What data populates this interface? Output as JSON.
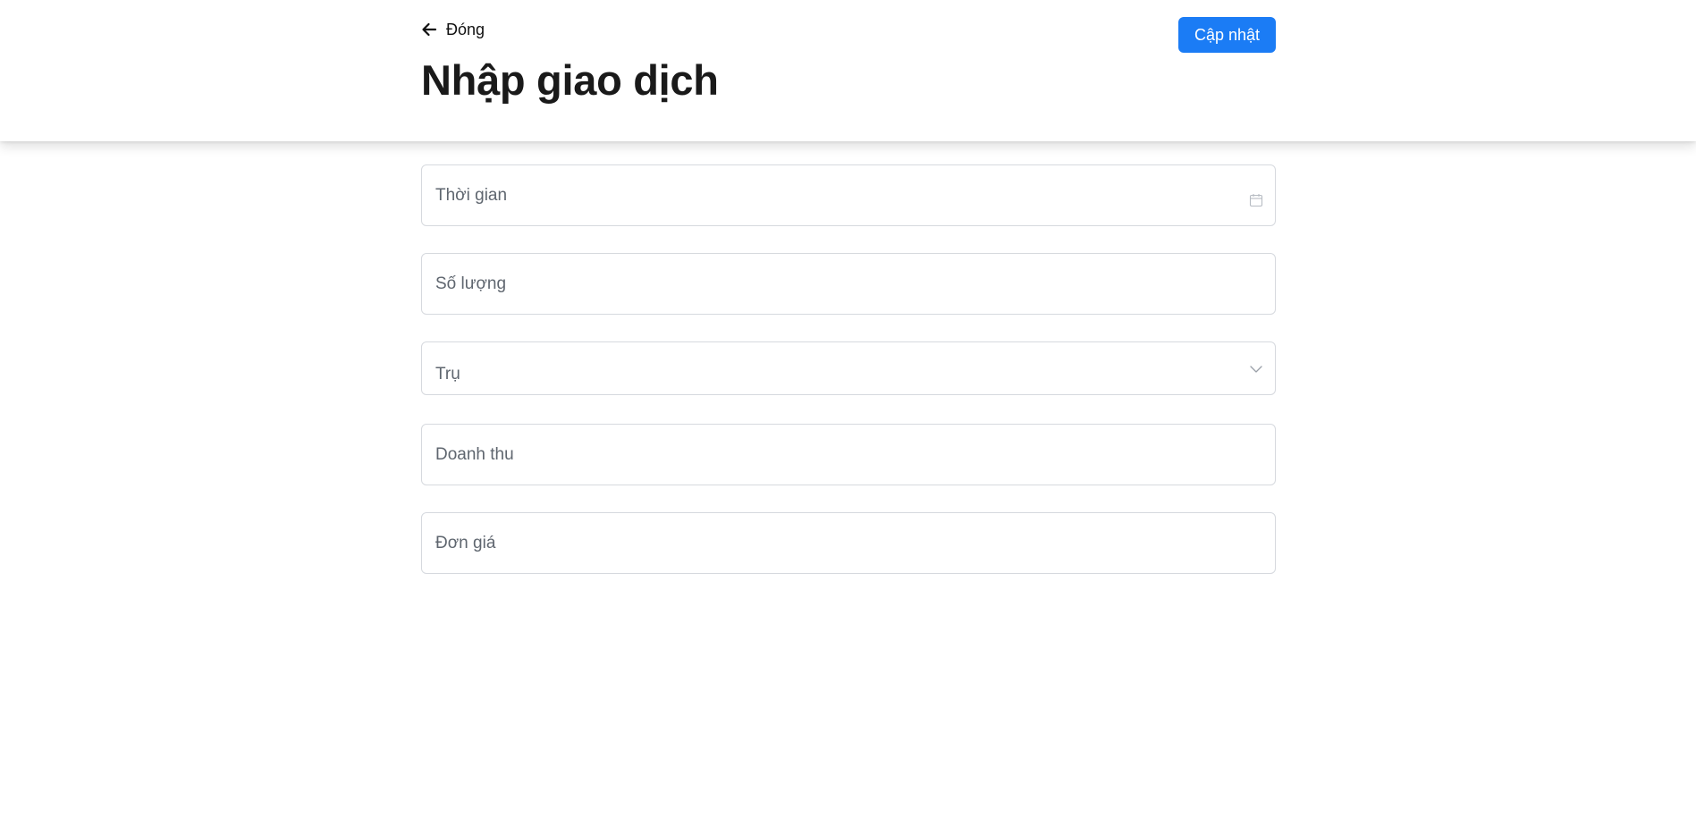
{
  "header": {
    "back_label": "Đóng",
    "title": "Nhập giao dịch",
    "update_label": "Cập nhật"
  },
  "form": {
    "fields": [
      {
        "label": "Thời gian",
        "icon": "calendar-icon"
      },
      {
        "label": "Số lượng"
      },
      {
        "label": "Trụ",
        "icon": "chevron-down-icon"
      },
      {
        "label": "Doanh thu"
      },
      {
        "label": "Đơn giá"
      }
    ]
  },
  "colors": {
    "accent": "#1b7cf5",
    "label_text": "#5f666f",
    "field_border": "#d6d9de"
  }
}
